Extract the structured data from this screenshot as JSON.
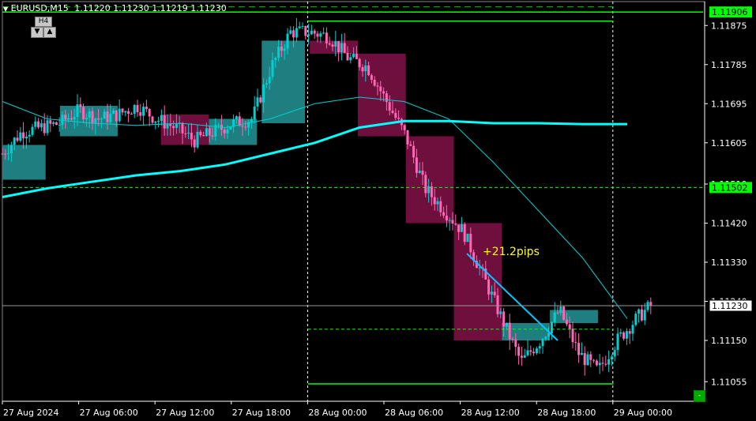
{
  "header": {
    "symbol": "EURUSD,M15",
    "ohlc": "1.11220 1.11230 1.11219 1.11230",
    "timeframe_button": "H4",
    "arrow_down": "▼",
    "arrow_up": "▲"
  },
  "annotation": {
    "text": "+21.2pips",
    "color": "#ffff00"
  },
  "colors": {
    "bull": "#00d0d0",
    "bear": "#ff66b3",
    "bull_box": "#1f7f80",
    "bear_box": "#6e0f3e",
    "level": "#00ff00",
    "ma_fast": "#00d0d0",
    "ma_slow": "#00ffff",
    "grid_dash": "#ffffff"
  },
  "chart_data": {
    "type": "candlestick",
    "ylim": [
      1.1101,
      1.1193
    ],
    "y_ticks": [
      "1.11875",
      "1.11785",
      "1.11695",
      "1.11605",
      "1.11510",
      "1.11420",
      "1.11330",
      "1.11240",
      "1.11150",
      "1.11055"
    ],
    "x_ticks": [
      "27 Aug 2024",
      "27 Aug 06:00",
      "27 Aug 12:00",
      "27 Aug 18:00",
      "28 Aug 00:00",
      "28 Aug 06:00",
      "28 Aug 12:00",
      "28 Aug 18:00",
      "29 Aug 00:00"
    ],
    "price_labels": [
      {
        "value": "1.11906",
        "price": 1.11906,
        "kind": "level"
      },
      {
        "value": "1.11502",
        "price": 1.11502,
        "kind": "level"
      },
      {
        "value": "1.11230",
        "price": 1.1123,
        "kind": "current"
      }
    ],
    "levels": [
      {
        "price": 1.11906,
        "style": "solid",
        "from_time": -2.5,
        "to_time": 22.0
      },
      {
        "price": 1.11502,
        "style": "dashed",
        "from_time": -2.5,
        "to_time": 22.0
      },
      {
        "price": 1.11885,
        "style": "solid",
        "from_time": 6.0,
        "to_time": 19.1
      },
      {
        "price": 1.1105,
        "style": "solid",
        "from_time": 6.0,
        "to_time": 19.1
      },
      {
        "price": 1.11176,
        "style": "dashed",
        "from_time": 6.0,
        "to_time": 19.1
      },
      {
        "price": 1.11918,
        "style": "dashed_top",
        "from_time": -2.5,
        "to_time": 19.1
      }
    ],
    "series": [
      {
        "name": "",
        "type": "line",
        "points": [
          [
            0,
            1.117
          ],
          [
            1,
            1.1166
          ],
          [
            2,
            1.1165
          ],
          [
            3,
            1.11645
          ],
          [
            4,
            1.1165
          ],
          [
            5,
            1.1164
          ],
          [
            6,
            1.1166
          ],
          [
            7,
            1.11695
          ],
          [
            8,
            1.1171
          ],
          [
            9,
            1.117
          ],
          [
            10,
            1.1166
          ],
          [
            11,
            1.1156
          ],
          [
            12,
            1.1145
          ],
          [
            13,
            1.1134
          ],
          [
            14,
            1.112
          ]
        ]
      },
      {
        "name": "",
        "type": "line",
        "points": [
          [
            0,
            1.1148
          ],
          [
            1,
            1.115
          ],
          [
            2,
            1.11515
          ],
          [
            3,
            1.1153
          ],
          [
            4,
            1.1154
          ],
          [
            5,
            1.11555
          ],
          [
            6,
            1.1158
          ],
          [
            7,
            1.11605
          ],
          [
            8,
            1.1164
          ],
          [
            9,
            1.11655
          ],
          [
            10,
            1.11655
          ],
          [
            11,
            1.1165
          ],
          [
            12,
            1.1165
          ],
          [
            13,
            1.11648
          ],
          [
            14,
            1.11648
          ]
        ]
      }
    ],
    "boxes": [
      {
        "t0": -2.4,
        "t1": -1.5,
        "p_open": 1.1152,
        "p_close": 1.116,
        "dir": "bull"
      },
      {
        "t0": -1.2,
        "t1": 0.0,
        "p_open": 1.1162,
        "p_close": 1.1169,
        "dir": "bull"
      },
      {
        "t0": 0.9,
        "t1": 1.9,
        "p_open": 1.1167,
        "p_close": 1.116,
        "dir": "bear"
      },
      {
        "t0": 1.9,
        "t1": 2.9,
        "p_open": 1.116,
        "p_close": 1.1166,
        "dir": "bull"
      },
      {
        "t0": 3.0,
        "t1": 3.9,
        "p_open": 1.1165,
        "p_close": 1.1184,
        "dir": "bull"
      },
      {
        "t0": 4.0,
        "t1": 5.0,
        "p_open": 1.1184,
        "p_close": 1.1181,
        "dir": "bear"
      },
      {
        "t0": 5.0,
        "t1": 6.0,
        "p_open": 1.1181,
        "p_close": 1.1162,
        "dir": "bear"
      },
      {
        "t0": 6.0,
        "t1": 7.0,
        "p_open": 1.1162,
        "p_close": 1.1142,
        "dir": "bear"
      },
      {
        "t0": 7.0,
        "t1": 8.0,
        "p_open": 1.1142,
        "p_close": 1.1115,
        "dir": "bear"
      },
      {
        "t0": 8.0,
        "t1": 9.0,
        "p_open": 1.1115,
        "p_close": 1.1119,
        "dir": "bull"
      },
      {
        "t0": 9.0,
        "t1": 10.0,
        "p_open": 1.1119,
        "p_close": 1.1122,
        "dir": "bull"
      }
    ],
    "trade_line": {
      "p_from": 1.1135,
      "p_to": 1.1115
    },
    "current_price": 1.1123
  }
}
